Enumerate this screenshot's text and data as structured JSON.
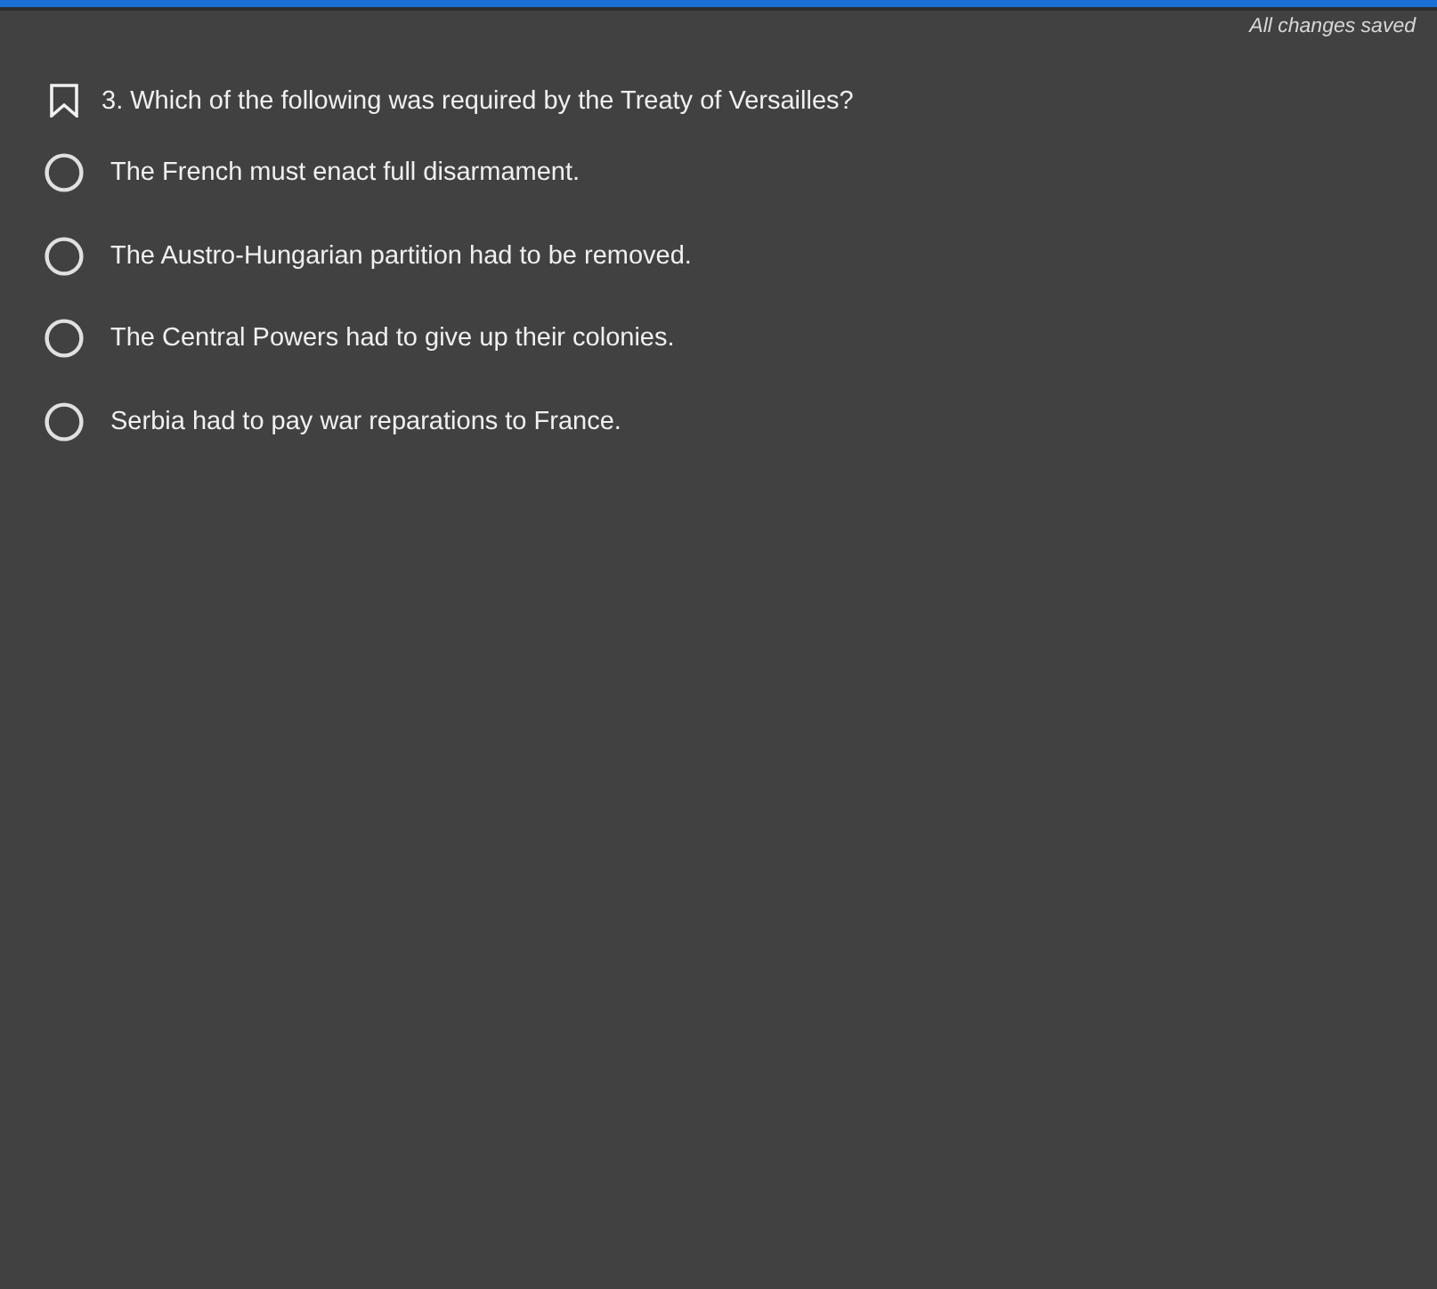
{
  "status": "All changes saved",
  "question": {
    "text": "3. Which of the following was required by the Treaty of Versailles?",
    "bookmarked": false
  },
  "options": [
    {
      "label": "The French must enact full disarmament.",
      "selected": false
    },
    {
      "label": "The Austro-Hungarian partition had to be removed.",
      "selected": false
    },
    {
      "label": "The Central Powers had to give up their colonies.",
      "selected": false
    },
    {
      "label": "Serbia had to pay war reparations to France.",
      "selected": false
    }
  ]
}
